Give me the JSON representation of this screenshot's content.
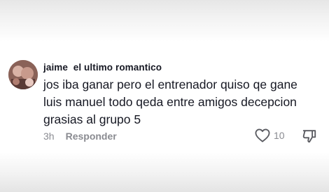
{
  "comment": {
    "username": "jaime  el ultimo romantico",
    "text_lines": [
      "jos iba ganar pero el entrenador quiso qe gane",
      "luis manuel todo qeda entre amigos decepcion",
      "grasias al grupo 5"
    ],
    "time": "3h",
    "reply_label": "Responder",
    "like_count": "10",
    "icons": {
      "like": "heart-outline-icon",
      "dislike": "thumbs-down-outline-icon"
    }
  }
}
